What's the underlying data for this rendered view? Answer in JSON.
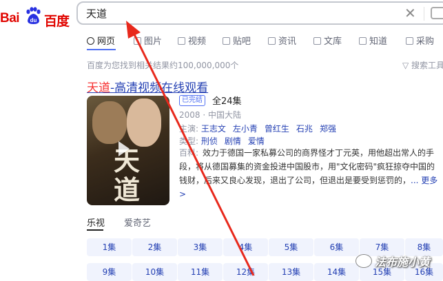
{
  "logo": {
    "part1": "Bai",
    "paw_text": "du",
    "part2": "百度"
  },
  "search": {
    "value": "天道"
  },
  "tabs": [
    {
      "label": "网页",
      "icon": "search-icon"
    },
    {
      "label": "图片",
      "icon": "image-icon"
    },
    {
      "label": "视频",
      "icon": "video-icon"
    },
    {
      "label": "贴吧",
      "icon": "tieba-icon"
    },
    {
      "label": "资讯",
      "icon": "news-icon"
    },
    {
      "label": "文库",
      "icon": "doc-icon"
    },
    {
      "label": "知道",
      "icon": "question-icon"
    },
    {
      "label": "采购",
      "icon": "cart-icon"
    }
  ],
  "result_count": "百度为您找到相关结果约100,000,000个",
  "search_tools": "搜索工具",
  "result": {
    "title_highlight": "天道",
    "title_rest": "-高清视频在线观看",
    "poster_text": "天道",
    "badge": "已完结",
    "episodes": "全24集",
    "year_region": "2008 · 中国大陆",
    "cast_label": "主演:",
    "cast": [
      "王志文",
      "左小青",
      "曾红生",
      "石兆",
      "郑强"
    ],
    "genre_label": "类型:",
    "genres": [
      "刑侦",
      "剧情",
      "爱情"
    ],
    "desc_label": "百科:",
    "desc": "效力于德国一家私募公司的商界怪才丁元英，用他超出常人的手段，将从德国募集的资金投进中国股市，用\"文化密码\"疯狂掠夺中国的钱财，后来又良心发现，退出了公司，但退出是要受到惩罚的，",
    "more": "... 更多 >"
  },
  "platforms": [
    "乐视",
    "爱奇艺"
  ],
  "episode_buttons": [
    "1集",
    "2集",
    "3集",
    "4集",
    "5集",
    "6集",
    "7集",
    "8集",
    "9集",
    "10集",
    "11集",
    "12集",
    "13集",
    "14集",
    "15集",
    "16集"
  ],
  "watermark": "法布施小黄",
  "colors": {
    "brand_red": "#e10601",
    "link_blue": "#2440b3",
    "accent": "#4e6ef2",
    "arrow_red": "#e8291c"
  }
}
